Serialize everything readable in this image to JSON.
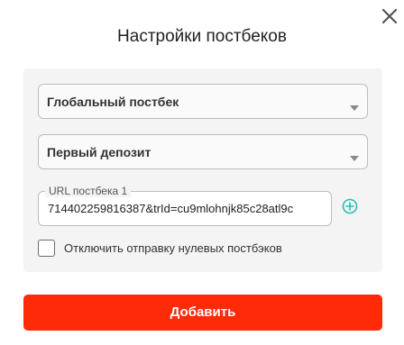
{
  "dialog": {
    "title": "Настройки постбеков",
    "close_icon": "close-icon"
  },
  "form": {
    "postback_type": {
      "value": "Глобальный постбек",
      "icon": "chevron-down-icon"
    },
    "event": {
      "value": "Первый депозит",
      "icon": "chevron-down-icon"
    },
    "url_field": {
      "label": "URL постбека 1",
      "value": "71440225981638​7&trId=cu9mlohnjk85c28atl9c"
    },
    "add_url_icon": "plus-circle-icon",
    "disable_zero_checkbox": {
      "label": "Отключить отправку нулевых постбэков",
      "checked": false
    }
  },
  "footer": {
    "add_button_label": "Добавить"
  },
  "colors": {
    "accent_red": "#fe2a08",
    "add_icon_teal": "#26bfae",
    "panel_bg": "#f4f4f4"
  }
}
